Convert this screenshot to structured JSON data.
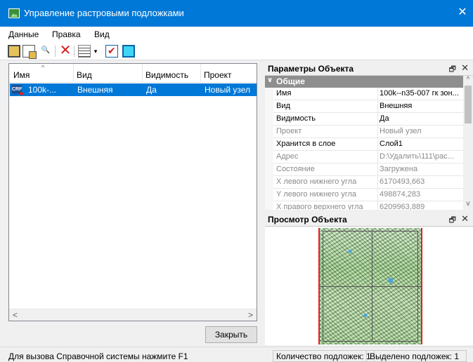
{
  "window": {
    "title": "Управление растровыми подложками",
    "close_glyph": "✕"
  },
  "menu": [
    "Данные",
    "Правка",
    "Вид"
  ],
  "toolbar": {
    "icons": [
      "open-icon",
      "copy-icon",
      "search-icon",
      "delete-icon",
      "list-view-icon",
      "checkbox-icon",
      "fill-icon"
    ],
    "dropdown_glyph": "▾",
    "delete_glyph": "✕",
    "search_glyph": "🔍"
  },
  "list": {
    "columns": [
      "Имя",
      "Вид",
      "Видимость",
      "Проект"
    ],
    "sort_glyph": "^",
    "rows": [
      {
        "icon_text": "CRF",
        "name": "100k-...",
        "kind": "Внешняя",
        "visibility": "Да",
        "project": "Новый узел",
        "selected": true
      }
    ],
    "scroll_left": "<",
    "scroll_right": ">"
  },
  "close_button": "Закрыть",
  "properties_panel": {
    "title": "Параметры Объекта",
    "pin_glyph": "🗗",
    "close_glyph": "✕",
    "group": "Общие",
    "group_chevron": "∨",
    "rows": [
      {
        "key": "Имя",
        "value": "100k--n35-007 гк зон...",
        "disabled": false
      },
      {
        "key": "Вид",
        "value": "Внешняя",
        "disabled": false
      },
      {
        "key": "Видимость",
        "value": "Да",
        "disabled": false
      },
      {
        "key": "Проект",
        "value": "Новый узел",
        "disabled": true
      },
      {
        "key": "Хранится в слое",
        "value": "Слой1",
        "disabled": false
      },
      {
        "key": "Адрес",
        "value": "D:\\Удалить\\111\\рас...",
        "disabled": true
      },
      {
        "key": "Состояние",
        "value": "Загружена",
        "disabled": true
      },
      {
        "key": "X левого нижнего угла",
        "value": "6170493,663",
        "disabled": true
      },
      {
        "key": "Y левого нижнего угла",
        "value": "498874,283",
        "disabled": true
      },
      {
        "key": "X правого верхнего угла",
        "value": "6209963,889",
        "disabled": true
      }
    ],
    "scroll_up": "^",
    "scroll_down": "v"
  },
  "preview_panel": {
    "title": "Просмотр Объекта",
    "pin_glyph": "🗗",
    "close_glyph": "✕"
  },
  "status": {
    "help": "Для вызова Справочной системы нажмите F1",
    "count": "Количество подложек: 1",
    "selected": "Выделено подложек: 1"
  }
}
